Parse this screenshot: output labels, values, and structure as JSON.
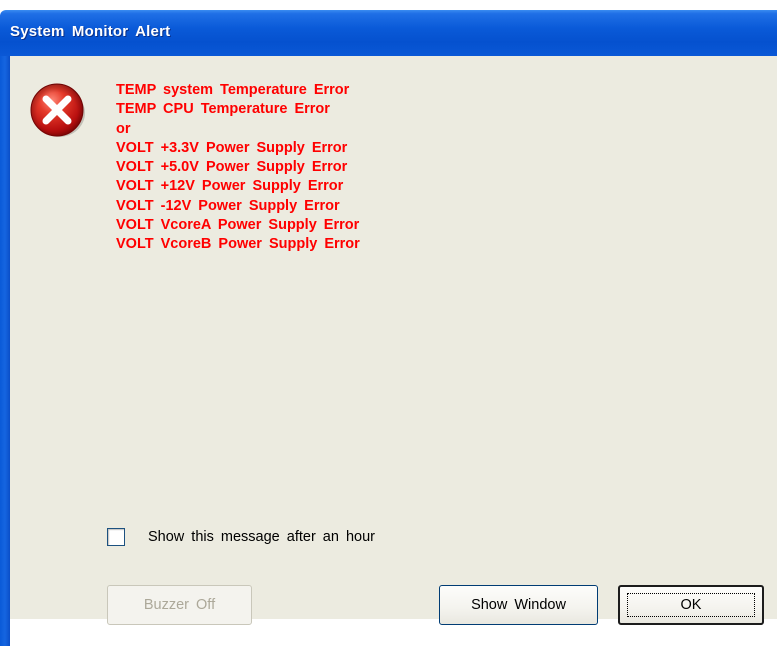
{
  "window": {
    "title": "System Monitor Alert"
  },
  "icons": {
    "error": "error-x-icon"
  },
  "colors": {
    "title_bar": "#0a5ad8",
    "client_bg": "#ecebe0",
    "message_text": "#ff0000",
    "error_icon": "#d21e1e"
  },
  "messages": [
    "TEMP system Temperature Error",
    "TEMP CPU Temperature Error",
    "or",
    "VOLT +3.3V Power Supply Error",
    "VOLT +5.0V Power Supply Error",
    "VOLT +12V Power Supply Error",
    "VOLT -12V Power Supply Error",
    "VOLT VcoreA Power Supply Error",
    "VOLT VcoreB Power Supply Error"
  ],
  "options": {
    "show_after_hour_label": "Show this message after an hour",
    "show_after_hour_checked": false
  },
  "buttons": {
    "buzzer_off": "Buzzer Off",
    "buzzer_off_enabled": false,
    "show_window": "Show Window",
    "ok": "OK"
  }
}
